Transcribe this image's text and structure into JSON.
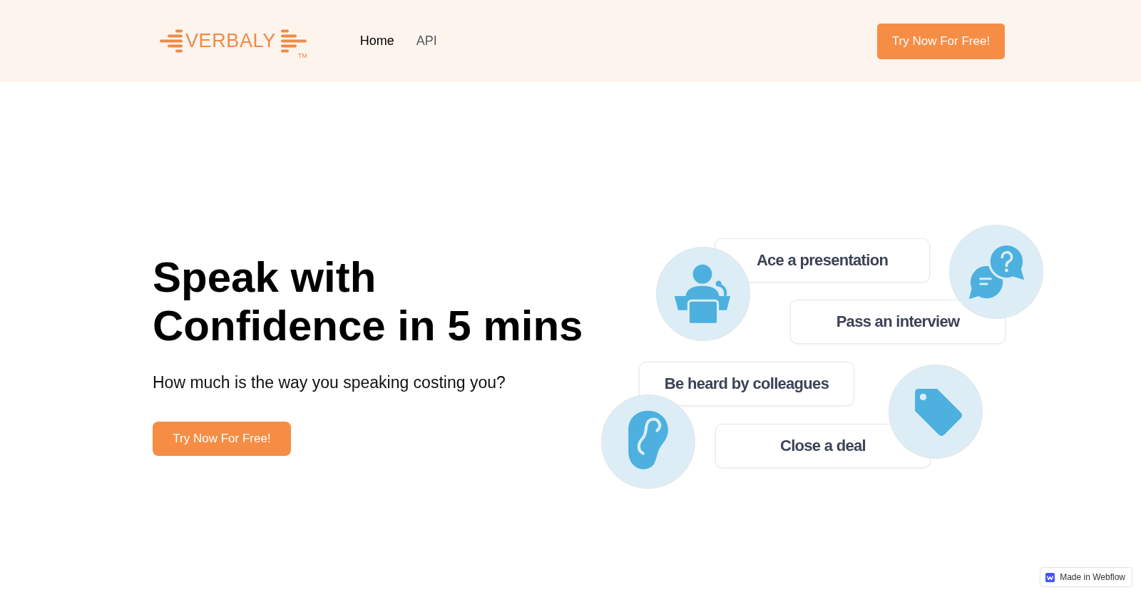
{
  "header": {
    "logo": {
      "wordmark": "VERBALY",
      "trademark": "TM"
    },
    "nav": [
      {
        "label": "Home",
        "selected": true
      },
      {
        "label": "API",
        "selected": false
      }
    ],
    "cta": "Try Now For Free!"
  },
  "hero": {
    "title_lines": [
      "Speak with",
      "Confidence in 5 mins"
    ],
    "subtitle": "How much is the way you speaking costing you?",
    "cta": "Try Now For Free!"
  },
  "illustration": {
    "goals": [
      "Ace a presentation",
      "Pass an interview",
      "Be heard by colleagues",
      "Close a deal"
    ]
  },
  "badge": {
    "label": "Made in Webflow"
  }
}
